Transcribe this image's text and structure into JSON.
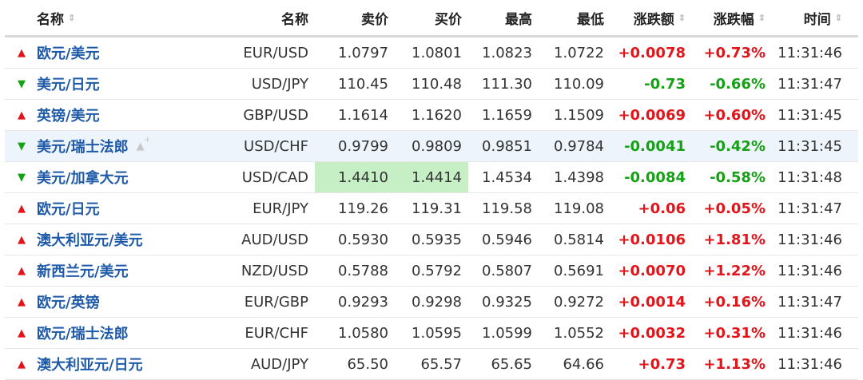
{
  "header": {
    "name": "名称",
    "code": "名称",
    "sell": "卖价",
    "buy": "买价",
    "high": "最高",
    "low": "最低",
    "change": "涨跌额",
    "pct": "涨跌幅",
    "time": "时间",
    "sort_glyph": "⇕"
  },
  "colors": {
    "up": "#e3141a",
    "down": "#14a214",
    "link": "#1e5aa8",
    "flash": "#c6efc6"
  },
  "rows": [
    {
      "name": "欧元/美元",
      "code": "EUR/USD",
      "sell": "1.0797",
      "buy": "1.0801",
      "high": "1.0823",
      "low": "1.0722",
      "change": "+0.0078",
      "pct": "+0.73%",
      "time": "11:31:46",
      "dir": "up"
    },
    {
      "name": "美元/日元",
      "code": "USD/JPY",
      "sell": "110.45",
      "buy": "110.48",
      "high": "111.30",
      "low": "110.09",
      "change": "-0.73",
      "pct": "-0.66%",
      "time": "11:31:47",
      "dir": "down"
    },
    {
      "name": "英镑/美元",
      "code": "GBP/USD",
      "sell": "1.1614",
      "buy": "1.1620",
      "high": "1.1659",
      "low": "1.1509",
      "change": "+0.0069",
      "pct": "+0.60%",
      "time": "11:31:45",
      "dir": "up"
    },
    {
      "name": "美元/瑞士法郎",
      "code": "USD/CHF",
      "sell": "0.9799",
      "buy": "0.9809",
      "high": "0.9851",
      "low": "0.9784",
      "change": "-0.0041",
      "pct": "-0.42%",
      "time": "11:31:45",
      "dir": "down",
      "hover": true
    },
    {
      "name": "美元/加拿大元",
      "code": "USD/CAD",
      "sell": "1.4410",
      "buy": "1.4414",
      "high": "1.4534",
      "low": "1.4398",
      "change": "-0.0084",
      "pct": "-0.58%",
      "time": "11:31:48",
      "dir": "down",
      "flash": true
    },
    {
      "name": "欧元/日元",
      "code": "EUR/JPY",
      "sell": "119.26",
      "buy": "119.31",
      "high": "119.58",
      "low": "119.08",
      "change": "+0.06",
      "pct": "+0.05%",
      "time": "11:31:47",
      "dir": "up"
    },
    {
      "name": "澳大利亚元/美元",
      "code": "AUD/USD",
      "sell": "0.5930",
      "buy": "0.5935",
      "high": "0.5946",
      "low": "0.5814",
      "change": "+0.0106",
      "pct": "+1.81%",
      "time": "11:31:46",
      "dir": "up"
    },
    {
      "name": "新西兰元/美元",
      "code": "NZD/USD",
      "sell": "0.5788",
      "buy": "0.5792",
      "high": "0.5807",
      "low": "0.5691",
      "change": "+0.0070",
      "pct": "+1.22%",
      "time": "11:31:46",
      "dir": "up"
    },
    {
      "name": "欧元/英镑",
      "code": "EUR/GBP",
      "sell": "0.9293",
      "buy": "0.9298",
      "high": "0.9325",
      "low": "0.9272",
      "change": "+0.0014",
      "pct": "+0.16%",
      "time": "11:31:47",
      "dir": "up"
    },
    {
      "name": "欧元/瑞士法郎",
      "code": "EUR/CHF",
      "sell": "1.0580",
      "buy": "1.0595",
      "high": "1.0599",
      "low": "1.0552",
      "change": "+0.0032",
      "pct": "+0.31%",
      "time": "11:31:46",
      "dir": "up"
    },
    {
      "name": "澳大利亚元/日元",
      "code": "AUD/JPY",
      "sell": "65.50",
      "buy": "65.57",
      "high": "65.65",
      "low": "64.66",
      "change": "+0.73",
      "pct": "+1.13%",
      "time": "11:31:46",
      "dir": "up"
    }
  ]
}
